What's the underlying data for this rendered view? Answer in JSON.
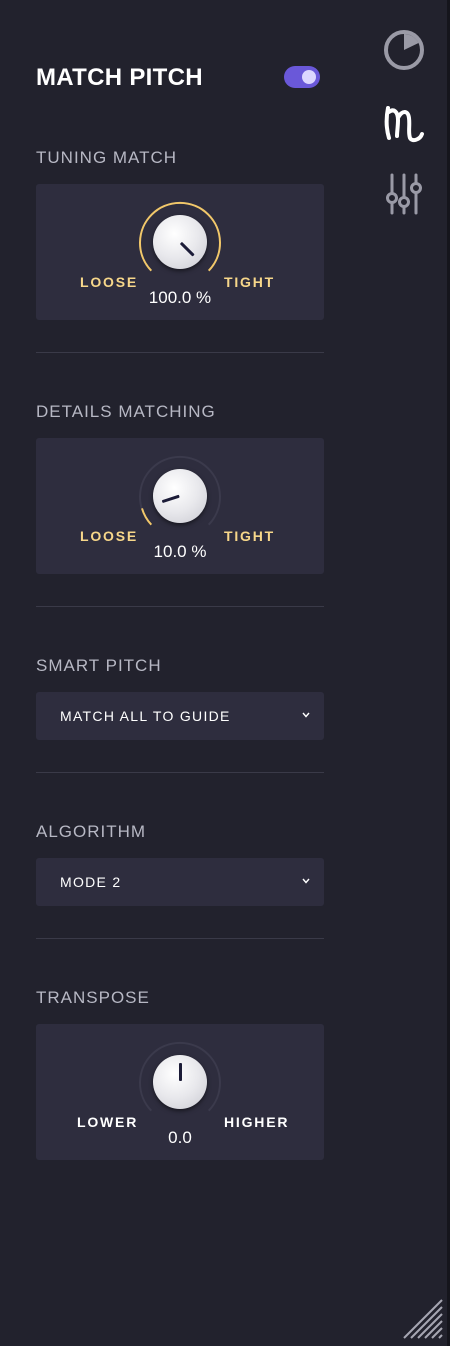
{
  "header": {
    "title": "MATCH PITCH",
    "toggle_on": true
  },
  "sidebar": {
    "icons": [
      {
        "name": "clock-meter-icon"
      },
      {
        "name": "melodyne-m-icon",
        "active": true
      },
      {
        "name": "mixer-sliders-icon"
      }
    ]
  },
  "sections": {
    "tuning": {
      "label": "TUNING MATCH",
      "left": "LOOSE",
      "right": "TIGHT",
      "value": "100.0 %",
      "percent": 100
    },
    "details": {
      "label": "DETAILS MATCHING",
      "left": "LOOSE",
      "right": "TIGHT",
      "value": "10.0 %",
      "percent": 10
    },
    "smart_pitch": {
      "label": "SMART PITCH",
      "selected": "MATCH ALL TO GUIDE"
    },
    "algorithm": {
      "label": "ALGORITHM",
      "selected": "MODE 2"
    },
    "transpose": {
      "label": "TRANSPOSE",
      "left": "LOWER",
      "right": "HIGHER",
      "value": "0.0"
    }
  },
  "colors": {
    "background": "#22222d",
    "card": "#2e2d3e",
    "accent_gold": "#f2c86a",
    "toggle": "#6a58d9",
    "label_gold": "#f7d78a",
    "label_white": "#ffffff"
  }
}
